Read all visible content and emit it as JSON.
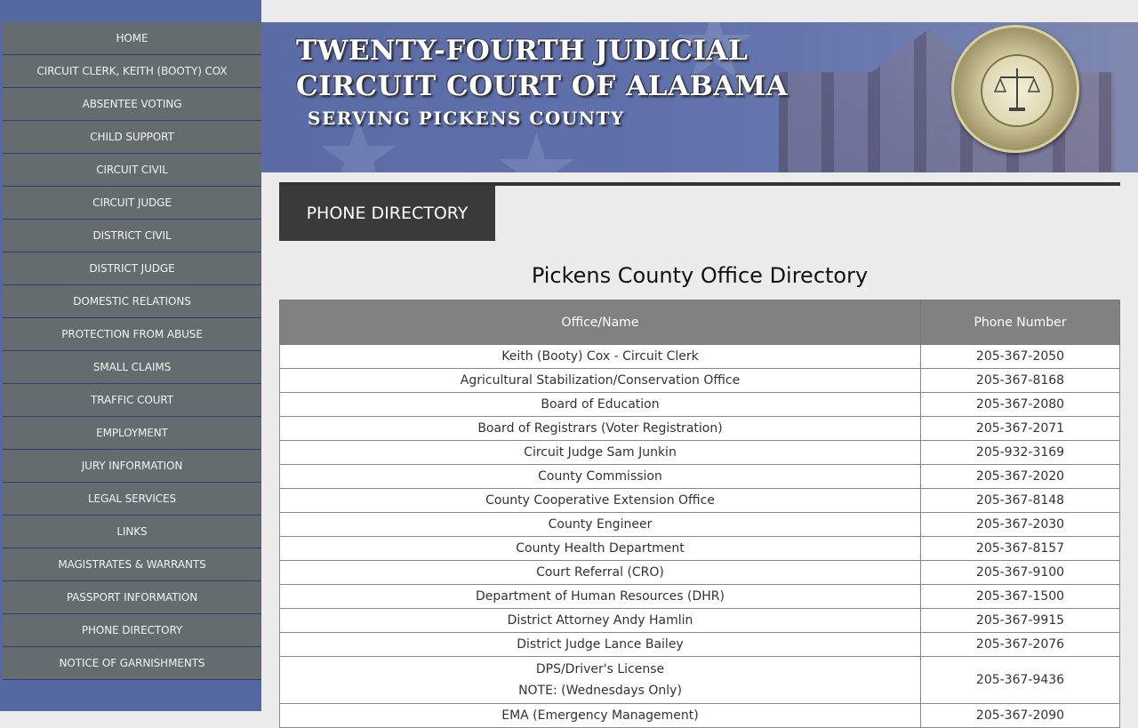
{
  "sidebar": {
    "items": [
      {
        "label": "HOME"
      },
      {
        "label": "CIRCUIT CLERK, KEITH (BOOTY) COX"
      },
      {
        "label": "ABSENTEE VOTING"
      },
      {
        "label": "CHILD SUPPORT"
      },
      {
        "label": "CIRCUIT CIVIL"
      },
      {
        "label": "CIRCUIT JUDGE"
      },
      {
        "label": "DISTRICT CIVIL"
      },
      {
        "label": "DISTRICT JUDGE"
      },
      {
        "label": "DOMESTIC RELATIONS"
      },
      {
        "label": "PROTECTION FROM ABUSE"
      },
      {
        "label": "SMALL CLAIMS"
      },
      {
        "label": "TRAFFIC COURT"
      },
      {
        "label": "EMPLOYMENT"
      },
      {
        "label": "JURY INFORMATION"
      },
      {
        "label": "LEGAL SERVICES"
      },
      {
        "label": "LINKS"
      },
      {
        "label": "MAGISTRATES & WARRANTS"
      },
      {
        "label": "PASSPORT INFORMATION"
      },
      {
        "label": "PHONE DIRECTORY"
      },
      {
        "label": "NOTICE OF GARNISHMENTS"
      }
    ]
  },
  "header": {
    "title_line1": "TWENTY-FOURTH JUDICIAL",
    "title_line2": "CIRCUIT COURT OF ALABAMA",
    "subtitle": "SERVING PICKENS COUNTY",
    "seal_text": "UNIFIED JUDICIAL SYSTEM · STATE OF ALABAMA"
  },
  "main": {
    "tab_label": "PHONE DIRECTORY",
    "directory_title": "Pickens County Office Directory",
    "table": {
      "headers": [
        "Office/Name",
        "Phone Number"
      ],
      "rows": [
        {
          "name": "Keith (Booty) Cox - Circuit Clerk",
          "phone": "205-367-2050"
        },
        {
          "name": "Agricultural Stabilization/Conservation Office",
          "phone": "205-367-8168"
        },
        {
          "name": "Board of Education",
          "phone": "205-367-2080"
        },
        {
          "name": "Board of Registrars (Voter Registration)",
          "phone": "205-367-2071"
        },
        {
          "name": "Circuit Judge Sam Junkin",
          "phone": "205-932-3169"
        },
        {
          "name": "County Commission",
          "phone": "205-367-2020"
        },
        {
          "name": "County Cooperative Extension Office",
          "phone": "205-367-8148"
        },
        {
          "name": "County Engineer",
          "phone": "205-367-2030"
        },
        {
          "name": "County Health Department",
          "phone": "205-367-8157"
        },
        {
          "name": "Court Referral (CRO)",
          "phone": "205-367-9100"
        },
        {
          "name": "Department of Human Resources (DHR)",
          "phone": "205-367-1500"
        },
        {
          "name": "District Attorney Andy Hamlin",
          "phone": "205-367-9915"
        },
        {
          "name": "District Judge Lance Bailey",
          "phone": "205-367-2076"
        },
        {
          "name": "DPS/Driver's License",
          "note": "NOTE: (Wednesdays Only)",
          "phone": "205-367-9436"
        },
        {
          "name": "EMA (Emergency Management)",
          "phone": "205-367-2090"
        }
      ]
    }
  }
}
